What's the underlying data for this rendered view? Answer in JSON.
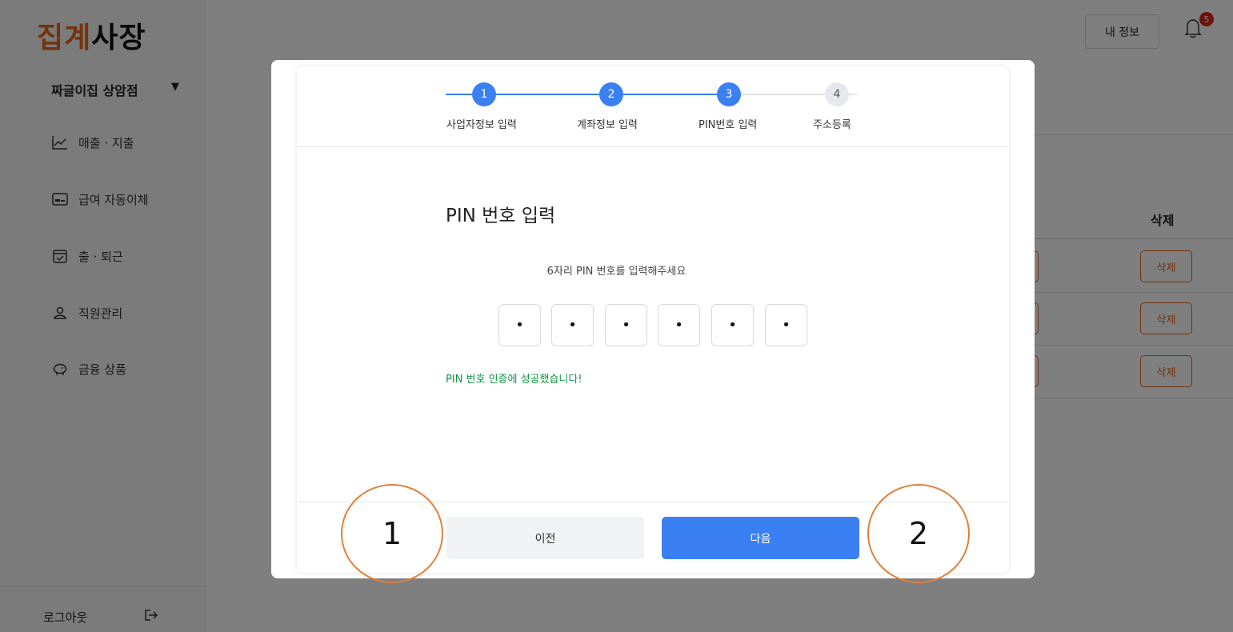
{
  "app": {
    "logo_part1": "집계",
    "logo_part2": "사장",
    "store_name": "짜글이집 상암점",
    "store_caret": "▼",
    "colors": {
      "brand": "#e8641b",
      "primary": "#3a80f2",
      "success": "#149447",
      "badge": "#d9261c"
    }
  },
  "sidebar": {
    "items": [
      {
        "label": "매출 · 지출",
        "icon": "chart-line-icon"
      },
      {
        "label": "급여 자동이체",
        "icon": "payroll-card-icon"
      },
      {
        "label": "출 · 퇴근",
        "icon": "calendar-check-icon"
      },
      {
        "label": "직원관리",
        "icon": "person-icon"
      },
      {
        "label": "금융 상품",
        "icon": "piggy-bank-icon"
      }
    ],
    "logout_label": "로그아웃",
    "logout_icon": "logout-icon"
  },
  "header": {
    "my_info_label": "내 정보",
    "notification_count": "5",
    "bell_icon": "bell-icon"
  },
  "table": {
    "column_header": "삭제",
    "rows": [
      {
        "delete_label": "삭제"
      },
      {
        "delete_label": "삭제"
      },
      {
        "delete_label": "삭제"
      }
    ]
  },
  "modal": {
    "steps": [
      {
        "number": "1",
        "label": "사업자정보 입력",
        "state": "done"
      },
      {
        "number": "2",
        "label": "계좌정보 입력",
        "state": "done"
      },
      {
        "number": "3",
        "label": "PIN번호 입력",
        "state": "done"
      },
      {
        "number": "4",
        "label": "주소등록",
        "state": "todo"
      }
    ],
    "title": "PIN 번호 입력",
    "description": "6자리 PIN 번호를 입력해주세요",
    "pin_digits": [
      "•",
      "•",
      "•",
      "•",
      "•",
      "•"
    ],
    "success_message": "PIN 번호 인증에 성공했습니다!",
    "prev_label": "이전",
    "next_label": "다음"
  },
  "annotations": [
    "1",
    "2"
  ]
}
